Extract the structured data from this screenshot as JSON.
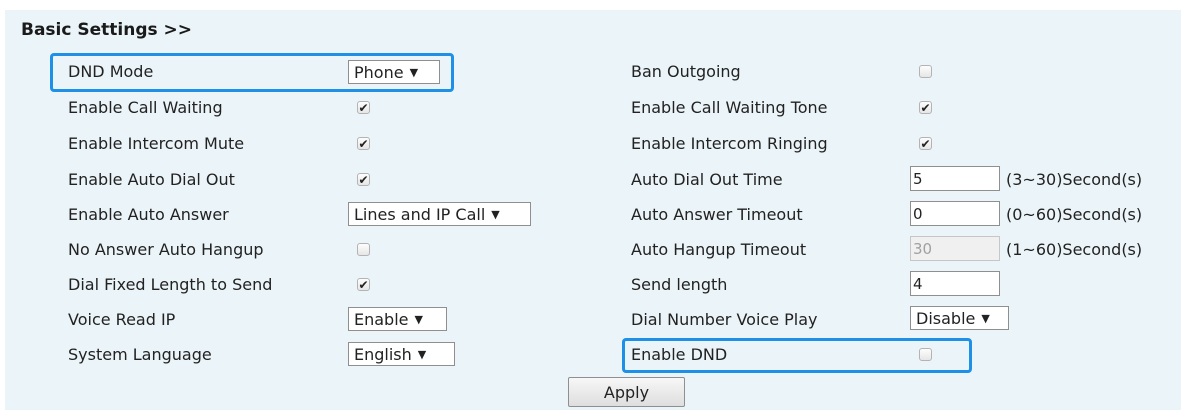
{
  "title": "Basic Settings >>",
  "left": {
    "dnd_mode": {
      "label": "DND Mode",
      "value": "Phone"
    },
    "call_waiting": {
      "label": "Enable Call Waiting",
      "checked": true
    },
    "intercom_mute": {
      "label": "Enable Intercom Mute",
      "checked": true
    },
    "auto_dial_out": {
      "label": "Enable Auto Dial Out",
      "checked": true
    },
    "auto_answer": {
      "label": "Enable Auto Answer",
      "value": "Lines and IP Call"
    },
    "no_answer_hangup": {
      "label": "No Answer Auto Hangup",
      "checked": false
    },
    "dial_fixed_length": {
      "label": "Dial Fixed Length to Send",
      "checked": true
    },
    "voice_read_ip": {
      "label": "Voice Read IP",
      "value": "Enable"
    },
    "system_language": {
      "label": "System Language",
      "value": "English"
    }
  },
  "right": {
    "ban_outgoing": {
      "label": "Ban Outgoing",
      "checked": false
    },
    "call_waiting_tone": {
      "label": "Enable Call Waiting Tone",
      "checked": true
    },
    "intercom_ringing": {
      "label": "Enable Intercom Ringing",
      "checked": true
    },
    "auto_dial_out_time": {
      "label": "Auto Dial Out Time",
      "value": "5",
      "unit": "(3~30)Second(s)"
    },
    "auto_answer_timeout": {
      "label": "Auto Answer Timeout",
      "value": "0",
      "unit": "(0~60)Second(s)"
    },
    "auto_hangup_timeout": {
      "label": "Auto Hangup Timeout",
      "value": "30",
      "unit": "(1~60)Second(s)",
      "disabled": true
    },
    "send_length": {
      "label": "Send length",
      "value": "4"
    },
    "dial_number_voice_play": {
      "label": "Dial Number Voice Play",
      "value": "Disable"
    },
    "enable_dnd": {
      "label": "Enable DND",
      "checked": false
    }
  },
  "apply_label": "Apply",
  "colors": {
    "panel_bg": "#ebf4f8",
    "highlight": "#1e90e8"
  },
  "icons": {
    "checkmark": "✔",
    "dropdown_arrow": "▼"
  }
}
